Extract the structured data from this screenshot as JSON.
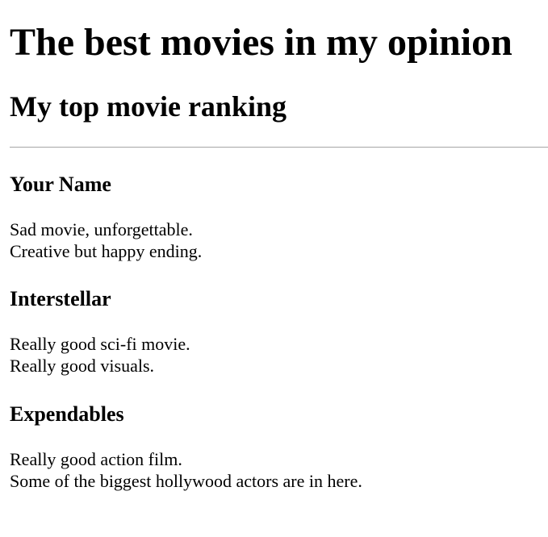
{
  "header": {
    "title": "The best movies in my opinion",
    "subtitle": "My top movie ranking"
  },
  "movies": [
    {
      "title": "Your Name",
      "lines": [
        "Sad movie, unforgettable.",
        "Creative but happy ending."
      ]
    },
    {
      "title": "Interstellar",
      "lines": [
        "Really good sci-fi movie.",
        "Really good visuals."
      ]
    },
    {
      "title": "Expendables",
      "lines": [
        "Really good action film.",
        "Some of the biggest hollywood actors are in here."
      ]
    }
  ]
}
